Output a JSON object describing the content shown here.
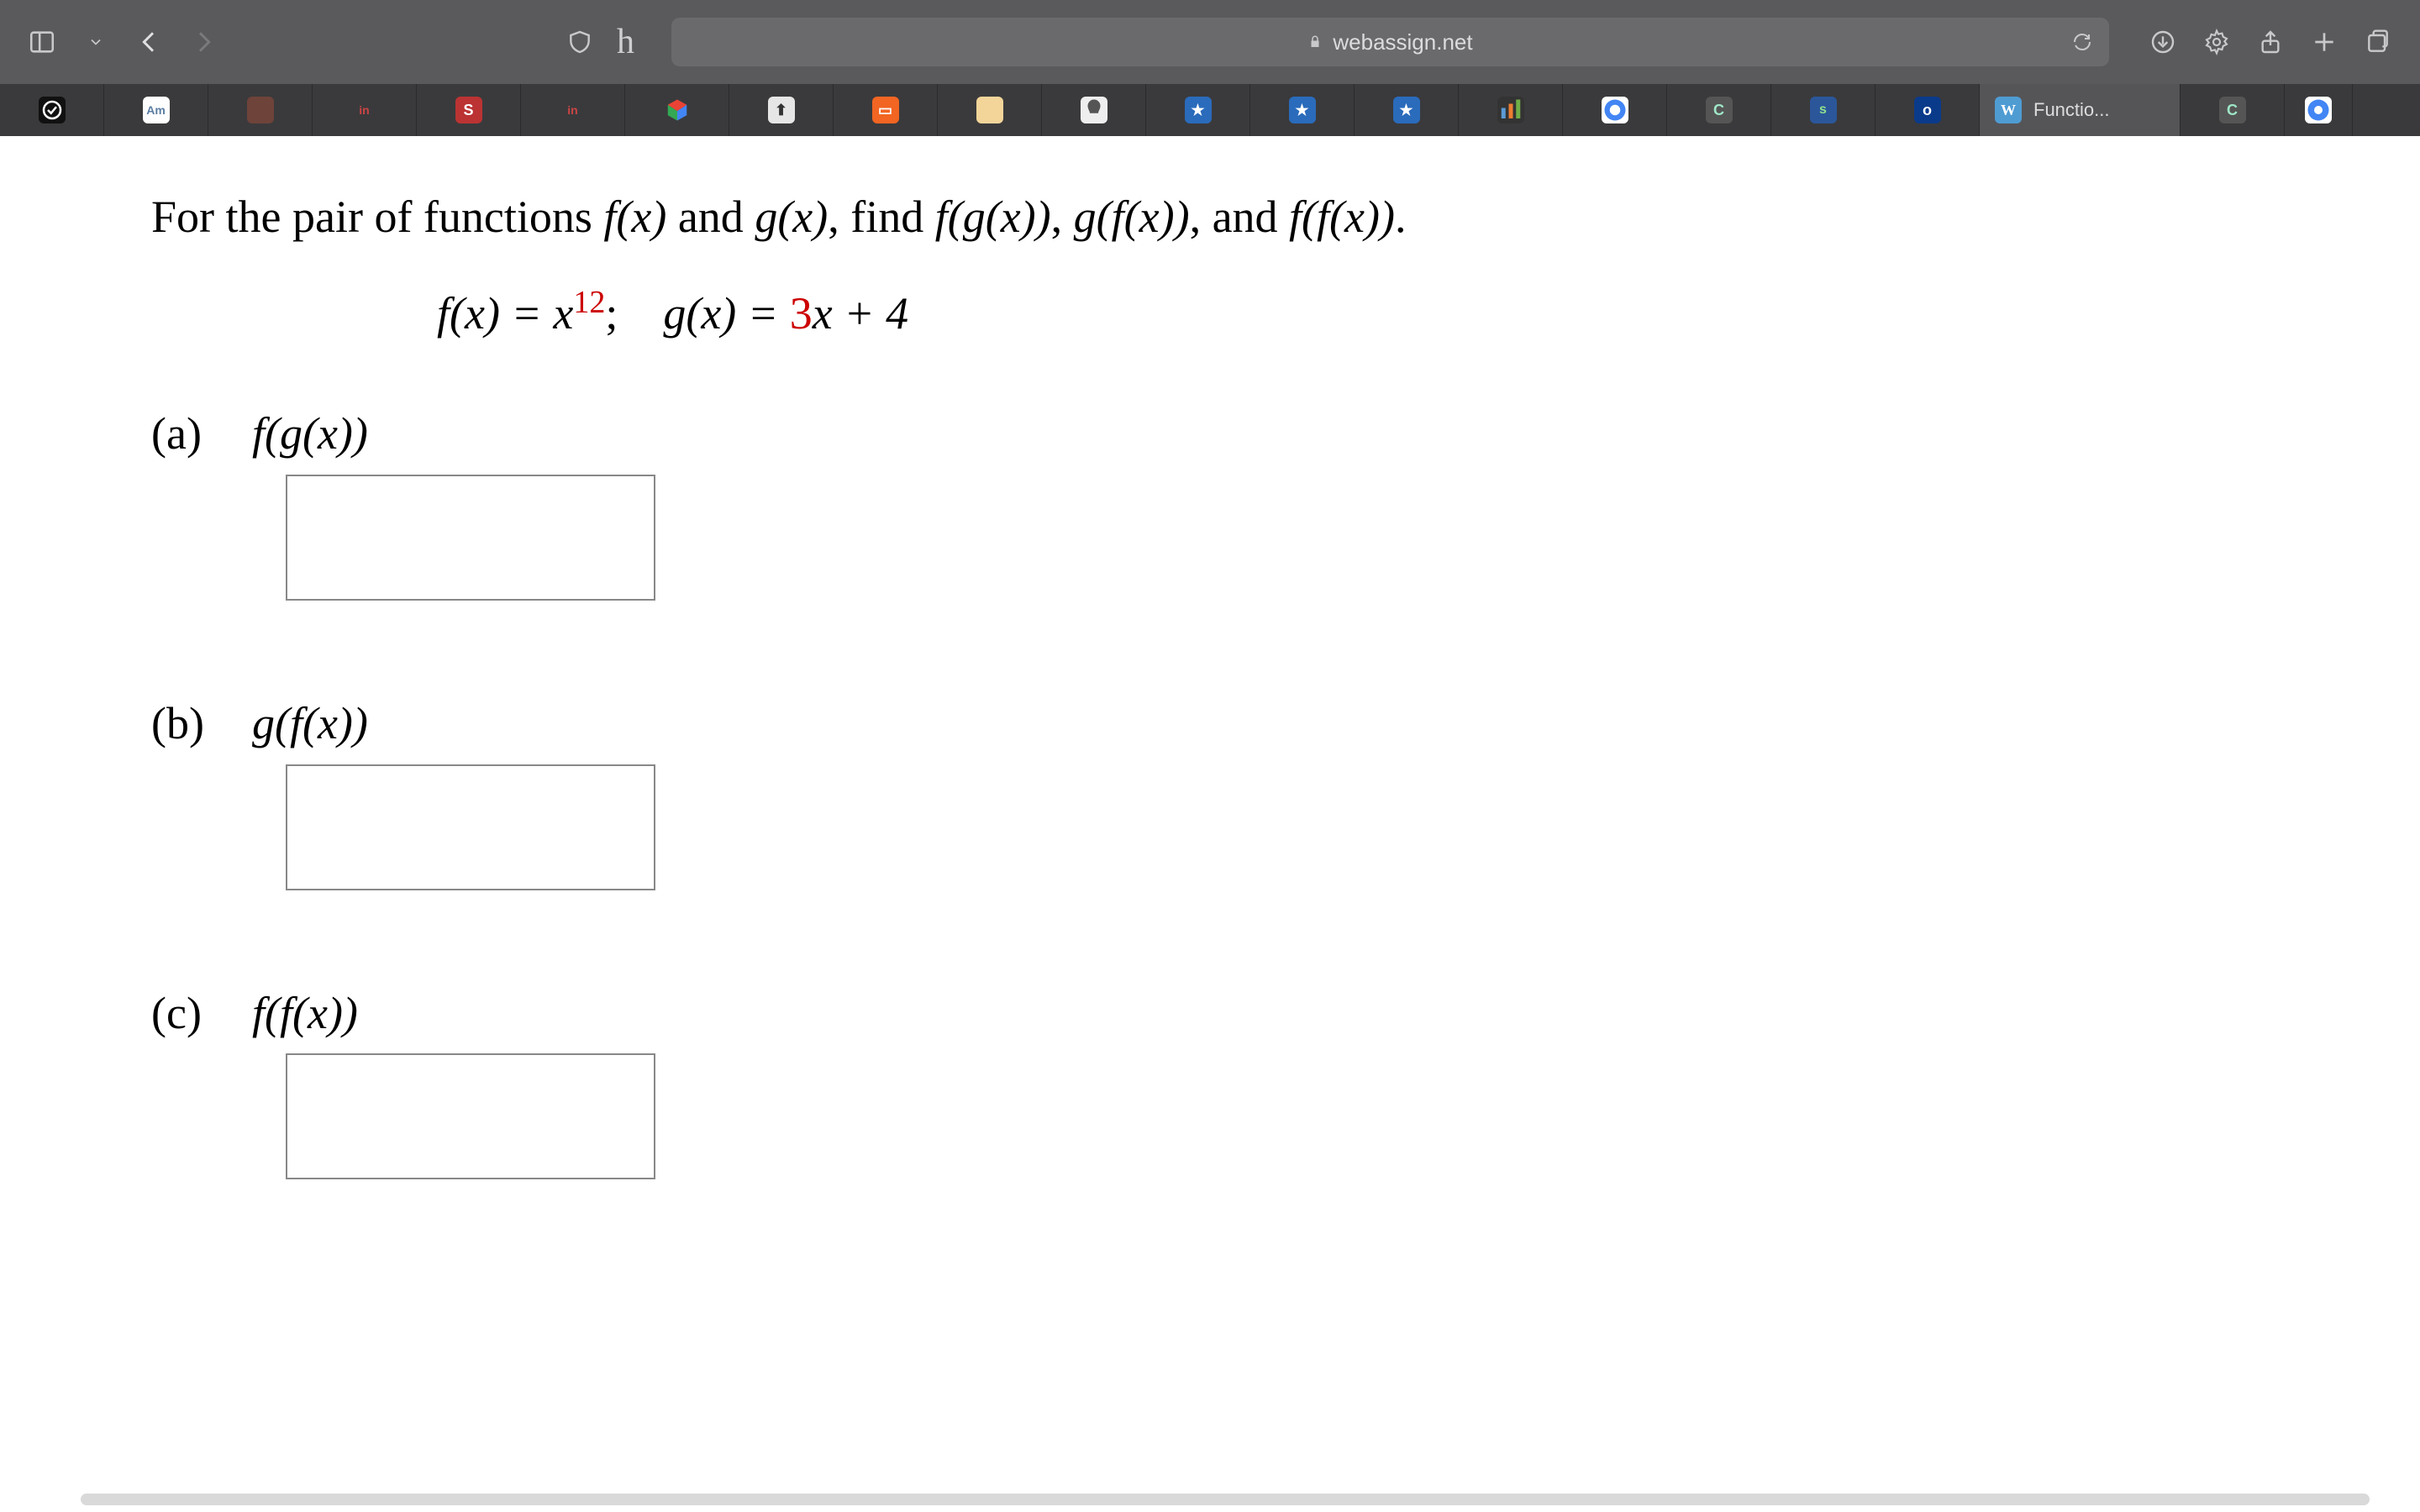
{
  "browser": {
    "url_host": "webassign.net",
    "active_tab_label": "Functio...",
    "active_tab_badge": "W"
  },
  "question": {
    "prompt_lead": "For the pair of functions ",
    "prompt_mid1": " and ",
    "prompt_mid2": ", find ",
    "prompt_comma": ", ",
    "prompt_and": ", and ",
    "prompt_period": ".",
    "fx": "f(x)",
    "gx": "g(x)",
    "fgx": "f(g(x))",
    "gfx": "g(f(x))",
    "ffx": "f(f(x))",
    "def_fx_lhs": "f(x) = x",
    "def_fx_exp": "12",
    "def_sep": "; ",
    "def_gx_lhs": "g(x) = ",
    "def_gx_coef": "3",
    "def_gx_tail": "x + 4",
    "parts": [
      {
        "label": "(a)",
        "expr": "f(g(x))"
      },
      {
        "label": "(b)",
        "expr": "g(f(x))"
      },
      {
        "label": "(c)",
        "expr": "f(f(x))"
      }
    ]
  }
}
